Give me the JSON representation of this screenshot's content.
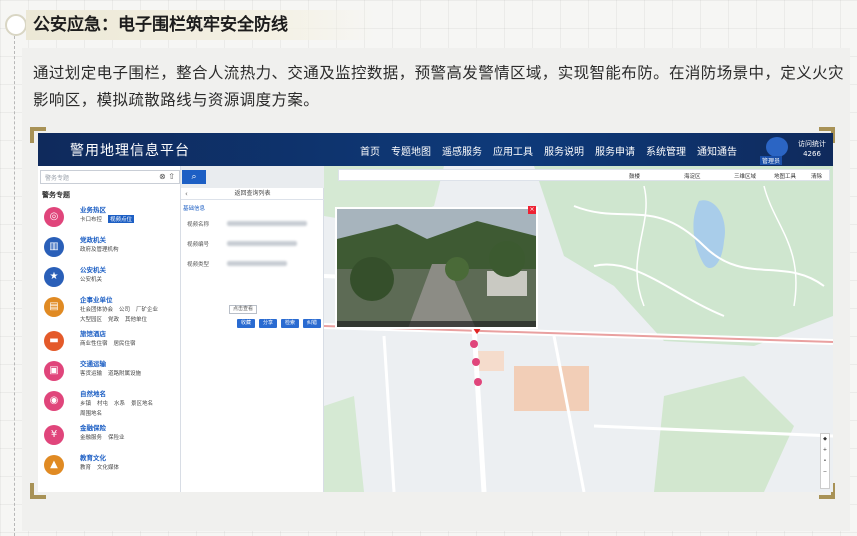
{
  "heading": {
    "title": "公安应急：电子围栏筑牢安全防线"
  },
  "description": "通过划定电子围栏，整合人流热力、交通及监控数据，预警高发警情区域，实现智能布防。在消防场景中，定义火灾影响区，模拟疏散路线与资源调度方案。",
  "platform": {
    "title": "警用地理信息平台",
    "nav": [
      "首页",
      "专题地图",
      "遥感服务",
      "应用工具",
      "服务说明",
      "服务申请",
      "系统管理",
      "通知通告"
    ],
    "user_label": "管理员",
    "visit_label": "访问统计",
    "visit_count": "4266",
    "search": {
      "placeholder": "警务专题"
    },
    "panel_title": "警务专题",
    "categories": [
      {
        "name": "业务热区",
        "items": [
          "卡口布控",
          "视频点位"
        ],
        "color": "#e0457b",
        "icon": "target-icon"
      },
      {
        "name": "党政机关",
        "items": [
          "政府及管理机构"
        ],
        "color": "#2a5fb8",
        "icon": "building-icon"
      },
      {
        "name": "公安机关",
        "items": [
          "公安机关"
        ],
        "color": "#2a5fb8",
        "icon": "police-badge-icon"
      },
      {
        "name": "企事业单位",
        "items": [
          "社会团体协会",
          "公司",
          "厂矿企业"
        ],
        "items2": [
          "大型园区",
          "党政",
          "其他单位"
        ],
        "color": "#e08a23",
        "icon": "briefcase-icon"
      },
      {
        "name": "旅馆酒店",
        "items": [
          "商业性住宿",
          "居民住宿"
        ],
        "color": "#e45a2a",
        "icon": "bed-icon"
      },
      {
        "name": "交通运输",
        "items": [
          "客货运输",
          "道路附属设施"
        ],
        "color": "#e0457b",
        "icon": "bus-icon"
      },
      {
        "name": "自然地名",
        "items": [
          "乡镇",
          "村屯",
          "水系",
          "景区地名"
        ],
        "items2": [
          "周围地名"
        ],
        "color": "#e0457b",
        "icon": "map-pin-icon"
      },
      {
        "name": "金融保险",
        "items": [
          "金融服务",
          "保险业"
        ],
        "color": "#e0457b",
        "icon": "coin-icon"
      },
      {
        "name": "教育文化",
        "items": [
          "教育",
          "文化媒体"
        ],
        "color": "#e08a23",
        "icon": "grad-cap-icon"
      }
    ],
    "detail": {
      "header": "返回查询列表",
      "sub": "基础信息",
      "fields": [
        "视频名称",
        "视频编号",
        "视频类型"
      ],
      "view_label": "点击查看",
      "actions": [
        "收藏",
        "分享",
        "检索",
        "纠错"
      ]
    },
    "toolbar": [
      "鼓楼",
      "海淀区",
      "三维区域",
      "地图工具",
      "清除"
    ]
  }
}
